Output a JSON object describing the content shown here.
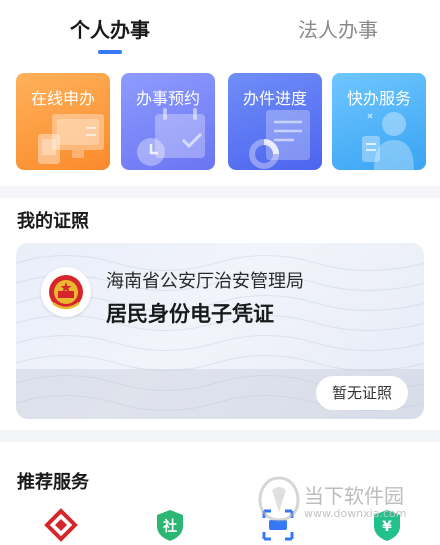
{
  "tabs": {
    "personal": "个人办事",
    "legal": "法人办事"
  },
  "quick_services": [
    {
      "label": "在线申办",
      "icon": "computer-icon"
    },
    {
      "label": "办事预约",
      "icon": "calendar-clock-icon"
    },
    {
      "label": "办件进度",
      "icon": "progress-document-icon"
    },
    {
      "label": "快办服务",
      "icon": "service-person-icon"
    }
  ],
  "certificates": {
    "title": "我的证照",
    "issuer": "海南省公安厅治安管理局",
    "name": "居民身份电子凭证",
    "button": "暂无证照"
  },
  "recommended": {
    "title": "推荐服务",
    "icons": [
      "housing-fund-icon",
      "social-security-icon",
      "medical-insurance-icon",
      "payment-icon"
    ]
  },
  "watermark": {
    "name": "当下软件园",
    "url": "www.downxia.com"
  },
  "colors": {
    "accent": "#3478f6",
    "orange": "#fb8a2c",
    "purple": "#6b74f2",
    "blue": "#4d64ee",
    "sky": "#3aa4f3"
  }
}
